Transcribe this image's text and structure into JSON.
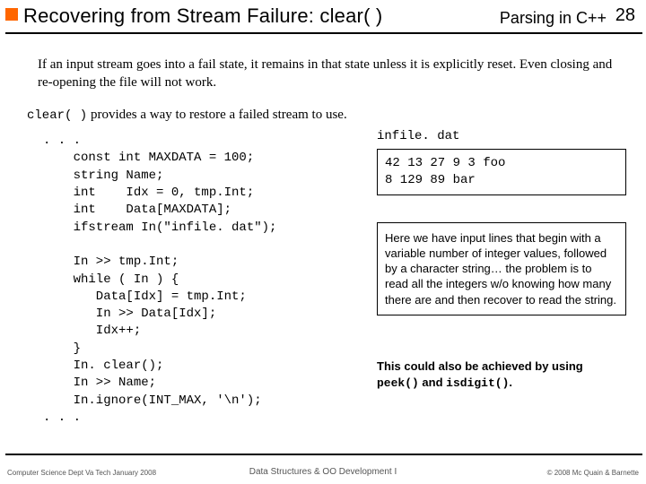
{
  "header": {
    "title": "Recovering from Stream Failure:  clear( )",
    "course": "Parsing in C++",
    "slide_number": "28"
  },
  "intro": "If an input stream goes into a fail state, it remains in that state unless it is explicitly reset. Even closing and re-opening the file will not work.",
  "clear_sentence": {
    "code": "clear( )",
    "rest": " provides a way to restore a failed stream to use."
  },
  "code": ". . .\n    const int MAXDATA = 100;\n    string Name;\n    int    Idx = 0, tmp.Int;\n    int    Data[MAXDATA];\n    ifstream In(\"infile. dat\");\n\n    In >> tmp.Int;\n    while ( In ) {\n       Data[Idx] = tmp.Int;\n       In >> Data[Idx];\n       Idx++;\n    }\n    In. clear();\n    In >> Name;\n    In.ignore(INT_MAX, '\\n');\n. . .",
  "datafile": {
    "name": "infile. dat",
    "contents": "42 13 27 9 3 foo\n8 129 89 bar"
  },
  "note1": "Here we have input lines that begin with a variable number of integer values, followed by a character string… the problem is to read all the integers w/o knowing how many there are and then recover to read the string.",
  "note2": {
    "t1": "This could also be achieved by using ",
    "m1": "peek()",
    "t2": " and ",
    "m2": "isdigit()",
    "t3": "."
  },
  "footer": {
    "left": "Computer Science Dept Va Tech January 2008",
    "center": "Data Structures & OO Development I",
    "right": "© 2008  Mc Quain & Barnette"
  }
}
